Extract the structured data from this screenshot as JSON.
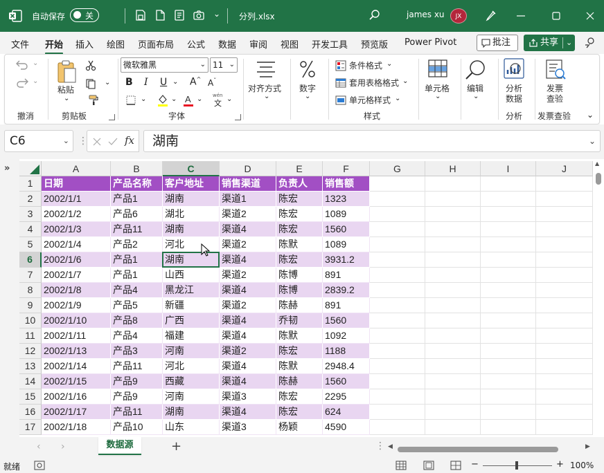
{
  "titlebar": {
    "autosave_label": "自动保存",
    "autosave_state": "关",
    "filename": "分列.xlsx",
    "user_name": "james xu",
    "user_initials": "JX"
  },
  "menu": {
    "tabs": [
      "文件",
      "开始",
      "插入",
      "绘图",
      "页面布局",
      "公式",
      "数据",
      "审阅",
      "视图",
      "开发工具",
      "预览版",
      "Power Pivot"
    ],
    "active_tab": "开始",
    "comment_label": "批注",
    "share_label": "共享"
  },
  "ribbon": {
    "undo_group": "撤消",
    "paste_label": "粘贴",
    "clipboard_group": "剪贴板",
    "font_name": "微软雅黑",
    "font_size": "11",
    "bold": "B",
    "italic": "I",
    "underline": "U",
    "grow_font": "A",
    "shrink_font": "A",
    "phonetic": "wén",
    "phonetic_char": "文",
    "font_color_letter": "A",
    "font_group": "字体",
    "align_label": "对齐方式",
    "number_label": "数字",
    "cond_format": "条件格式",
    "table_format": "套用表格格式",
    "cell_style": "单元格样式",
    "styles_group": "样式",
    "cells_label": "单元格",
    "edit_label": "编辑",
    "analyze_label1": "分析",
    "analyze_label2": "数据",
    "analyze_group": "分析",
    "invoice_label1": "发票",
    "invoice_label2": "查验",
    "invoice_group": "发票查验",
    "colors": {
      "fill_highlight": "#ffff00",
      "font_red": "#e81123"
    }
  },
  "formula_bar": {
    "name_box": "C6",
    "fx": "fx",
    "content": "湖南"
  },
  "grid": {
    "columns": [
      "A",
      "B",
      "C",
      "D",
      "E",
      "F",
      "G",
      "H",
      "I",
      "J"
    ],
    "selected_column": "C",
    "selected_row": "6",
    "row_numbers": [
      "1",
      "2",
      "3",
      "4",
      "5",
      "6",
      "7",
      "8",
      "9",
      "10",
      "11",
      "12",
      "13",
      "14",
      "15",
      "16",
      "17"
    ],
    "headers": [
      "日期",
      "产品名称",
      "客户地址",
      "销售渠道",
      "负责人",
      "销售额"
    ],
    "rows": [
      [
        "2002/1/1",
        "产品1",
        "湖南",
        "渠道1",
        "陈宏",
        "1323"
      ],
      [
        "2002/1/2",
        "产品6",
        "湖北",
        "渠道2",
        "陈宏",
        "1089"
      ],
      [
        "2002/1/3",
        "产品11",
        "湖南",
        "渠道4",
        "陈宏",
        "1560"
      ],
      [
        "2002/1/4",
        "产品2",
        "河北",
        "渠道2",
        "陈默",
        "1089"
      ],
      [
        "2002/1/6",
        "产品1",
        "湖南",
        "渠道4",
        "陈宏",
        "3931.2"
      ],
      [
        "2002/1/7",
        "产品1",
        "山西",
        "渠道2",
        "陈博",
        "891"
      ],
      [
        "2002/1/8",
        "产品4",
        "黑龙江",
        "渠道4",
        "陈博",
        "2839.2"
      ],
      [
        "2002/1/9",
        "产品5",
        "新疆",
        "渠道2",
        "陈赫",
        "891"
      ],
      [
        "2002/1/10",
        "产品8",
        "广西",
        "渠道4",
        "乔韧",
        "1560"
      ],
      [
        "2002/1/11",
        "产品4",
        "福建",
        "渠道4",
        "陈默",
        "1092"
      ],
      [
        "2002/1/13",
        "产品3",
        "河南",
        "渠道2",
        "陈宏",
        "1188"
      ],
      [
        "2002/1/14",
        "产品11",
        "河北",
        "渠道4",
        "陈默",
        "2948.4"
      ],
      [
        "2002/1/15",
        "产品9",
        "西藏",
        "渠道4",
        "陈赫",
        "1560"
      ],
      [
        "2002/1/16",
        "产品9",
        "河南",
        "渠道3",
        "陈宏",
        "2295"
      ],
      [
        "2002/1/17",
        "产品11",
        "湖南",
        "渠道4",
        "陈宏",
        "624"
      ],
      [
        "2002/1/18",
        "产品10",
        "山东",
        "渠道3",
        "杨颖",
        "4590"
      ]
    ],
    "colors": {
      "header_bg": "#a24fc4",
      "band_bg": "#e9d6f1"
    }
  },
  "sheet_tabs": {
    "active": "数据源",
    "add": "+"
  },
  "statusbar": {
    "ready": "就绪",
    "zoom_minus": "−",
    "zoom_plus": "+",
    "zoom_percent": "100%"
  }
}
